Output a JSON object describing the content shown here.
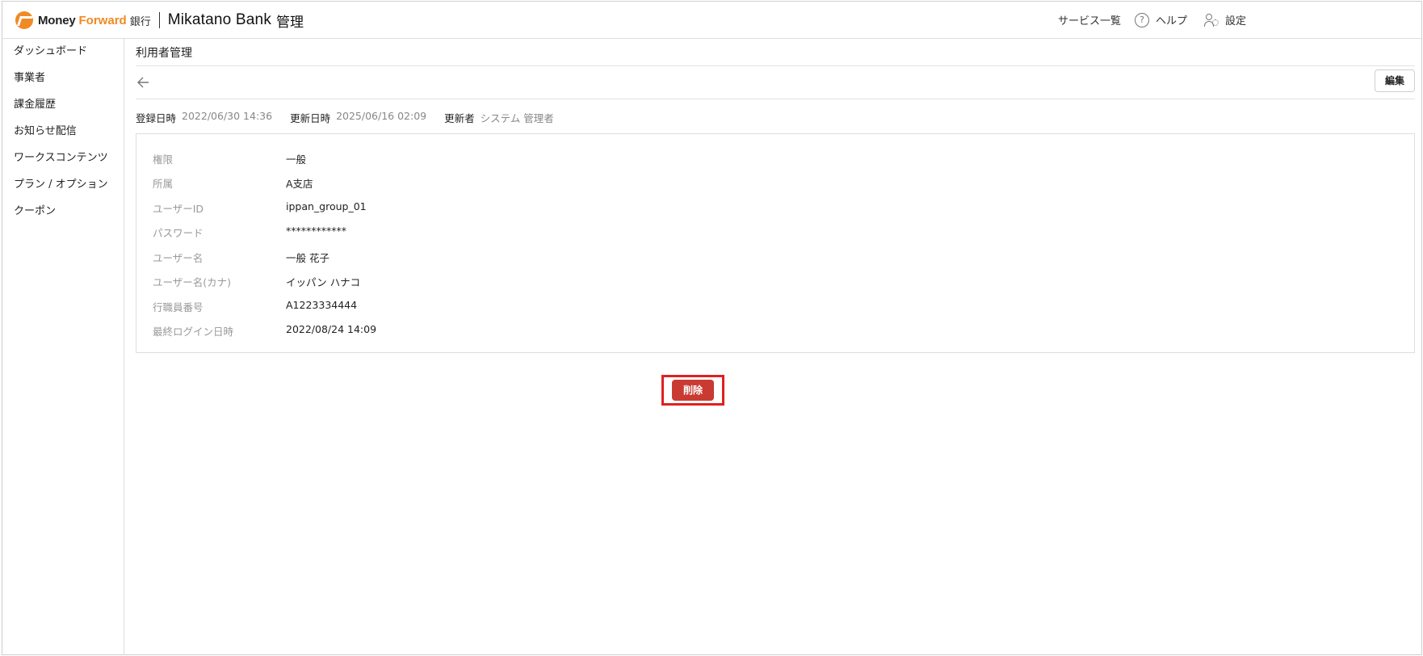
{
  "header": {
    "brand": {
      "money": "Money",
      "forward": "Forward",
      "ginko": "銀行",
      "product": "Mikatano",
      "bank": "Bank",
      "kanri": "管理"
    },
    "menu": [
      {
        "label": "サービス一覧",
        "icon": "apps-grid-icon"
      },
      {
        "label": "ヘルプ",
        "icon": "help-circle-icon"
      },
      {
        "label": "設定",
        "icon": "user-settings-icon"
      }
    ]
  },
  "sidebar": {
    "items": [
      {
        "label": "ダッシュボード"
      },
      {
        "label": "事業者"
      },
      {
        "label": "課金履歴"
      },
      {
        "label": "お知らせ配信"
      },
      {
        "label": "ワークスコンテンツ"
      },
      {
        "label": "プラン / オプション"
      },
      {
        "label": "クーポン"
      }
    ]
  },
  "main": {
    "title": "利用者管理",
    "edit_label": "編集",
    "meta": {
      "registered_label": "登録日時",
      "registered_value": "2022/06/30 14:36",
      "updated_label": "更新日時",
      "updated_value": "2025/06/16 02:09",
      "updater_label": "更新者",
      "updater_value": "システム 管理者"
    },
    "details": [
      {
        "label": "権限",
        "value": "一般"
      },
      {
        "label": "所属",
        "value": "A支店"
      },
      {
        "label": "ユーザーID",
        "value": "ippan_group_01"
      },
      {
        "label": "パスワード",
        "value": "************"
      },
      {
        "label": "ユーザー名",
        "value": "一般 花子"
      },
      {
        "label": "ユーザー名(カナ)",
        "value": "イッパン ハナコ"
      },
      {
        "label": "行職員番号",
        "value": "A1223334444"
      },
      {
        "label": "最終ログイン日時",
        "value": "2022/08/24 14:09"
      }
    ],
    "delete_label": "削除"
  },
  "colors": {
    "accent": "#f08a24",
    "danger": "#c93b32",
    "highlight": "#e02020"
  }
}
